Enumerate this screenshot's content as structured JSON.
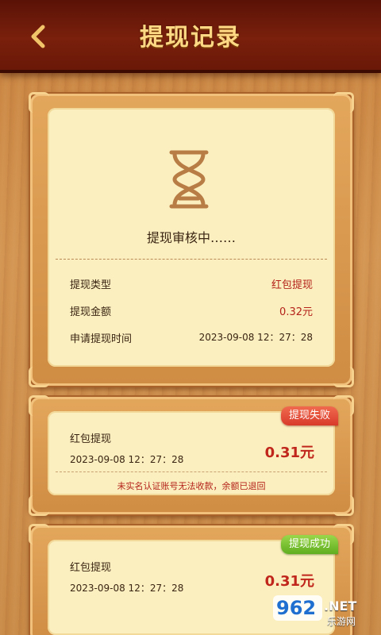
{
  "header": {
    "title": "提现记录",
    "back_icon": "chevron-left-icon"
  },
  "pending": {
    "status": "提现审核中……",
    "icon": "hourglass-icon",
    "rows": [
      {
        "label": "提现类型",
        "value": "红包提现"
      },
      {
        "label": "提现金额",
        "value": "0.32元"
      },
      {
        "label": "申请提现时间",
        "value": "2023-09-08 12：27：28"
      }
    ]
  },
  "records": [
    {
      "type": "红包提现",
      "time": "2023-09-08 12：27：28",
      "amount": "0.31元",
      "badge": "提现失败",
      "note": "未实名认证账号无法收款，余额已退回"
    },
    {
      "type": "红包提现",
      "time": "2023-09-08 12：27：28",
      "amount": "0.31元",
      "badge": "提现成功"
    }
  ],
  "watermark": {
    "brand": "962",
    "suffix": ".NET",
    "sub": "乐游网"
  },
  "colors": {
    "header_bg": "#6a1808",
    "title": "#ffd984",
    "accent_red": "#c0261b",
    "fail": "#d93a2a",
    "success": "#5fae1f",
    "panel": "#fbefbf"
  }
}
